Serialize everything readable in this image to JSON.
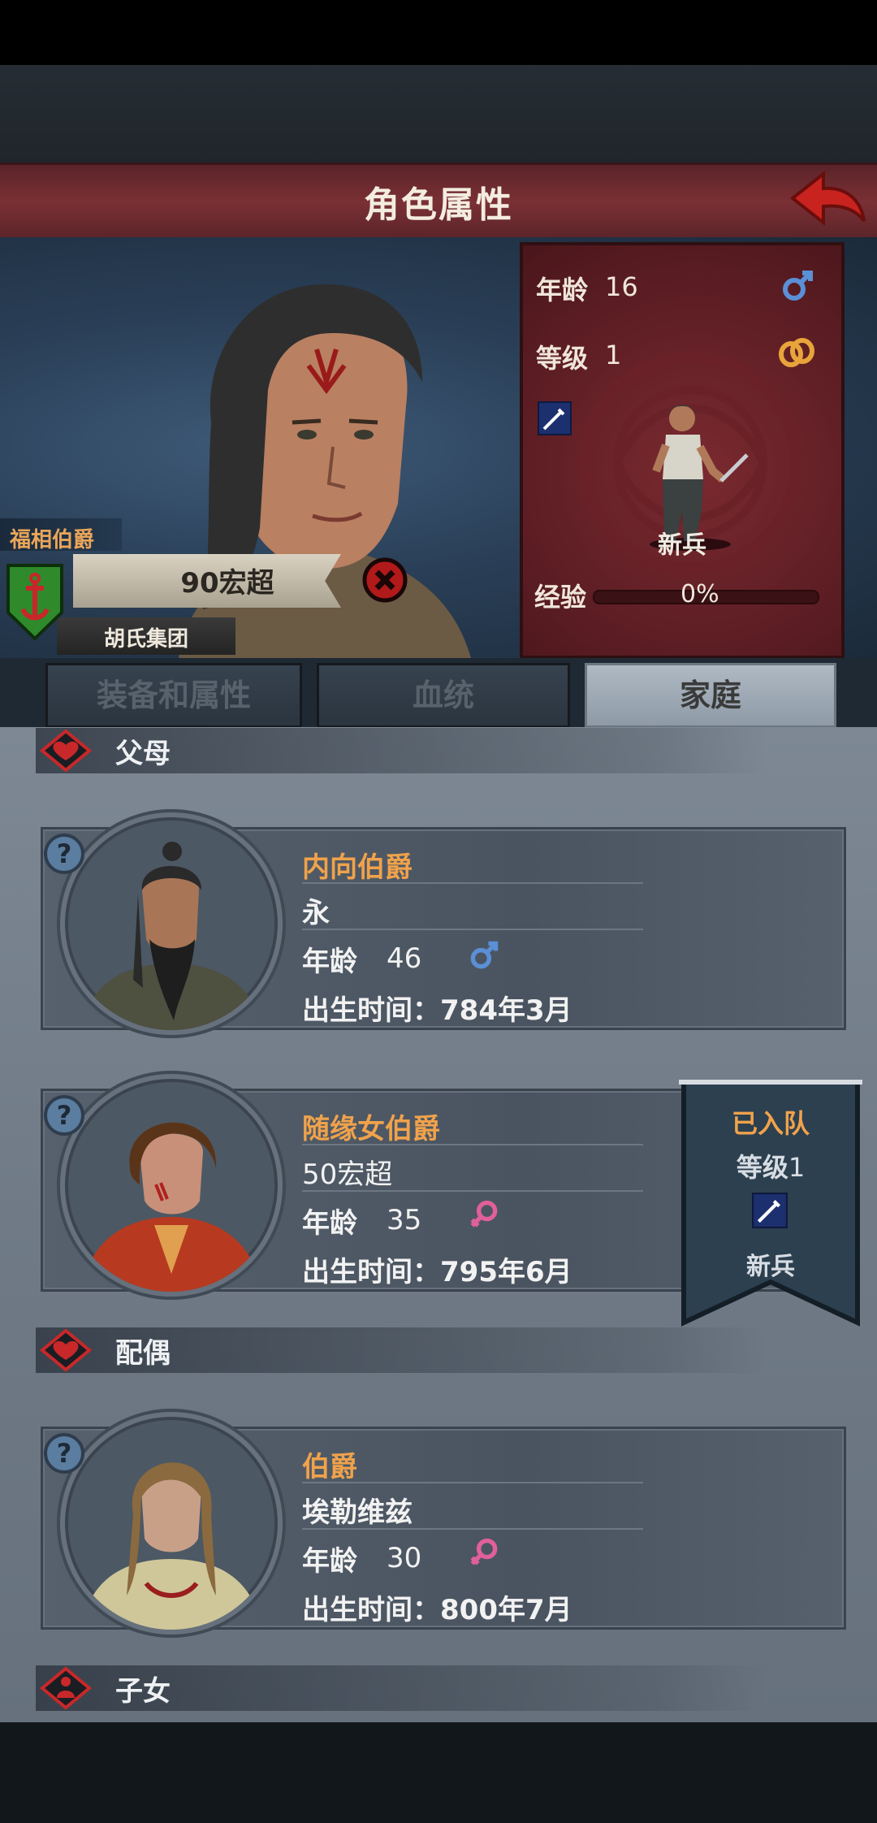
{
  "header": {
    "title": "角色属性"
  },
  "character": {
    "noble_title": "福相伯爵",
    "name": "90宏超",
    "clan": "胡氏集团",
    "age_label": "年龄",
    "age": "16",
    "level_label": "等级",
    "level": "1",
    "unit_type": "新兵",
    "xp_label": "经验",
    "xp": "0%",
    "xp_fraction": 0.0
  },
  "tabs": [
    {
      "label": "装备和属性",
      "active": false
    },
    {
      "label": "血统",
      "active": false
    },
    {
      "label": "家庭",
      "active": true
    }
  ],
  "sections": {
    "parents": "父母",
    "spouse": "配偶",
    "children": "子女"
  },
  "family": [
    {
      "title": "内向伯爵",
      "name": "永",
      "age_label": "年龄",
      "age": "46",
      "gender": "male",
      "birth": "出生时间：784年3月"
    },
    {
      "title": "随缘女伯爵",
      "name": "50宏超",
      "age_label": "年龄",
      "age": "35",
      "gender": "female",
      "birth": "出生时间：795年6月"
    },
    {
      "title": "伯爵",
      "name": "埃勒维兹",
      "age_label": "年龄",
      "age": "30",
      "gender": "female",
      "birth": "出生时间：800年7月"
    }
  ],
  "party_badge": {
    "status": "已入队",
    "level_label": "等级",
    "level": "1",
    "unit_type": "新兵"
  },
  "colors": {
    "accent_orange": "#f0a24b",
    "title_red": "#7a3035",
    "male_blue": "#5b8fd6",
    "female_pink": "#e0609a"
  }
}
